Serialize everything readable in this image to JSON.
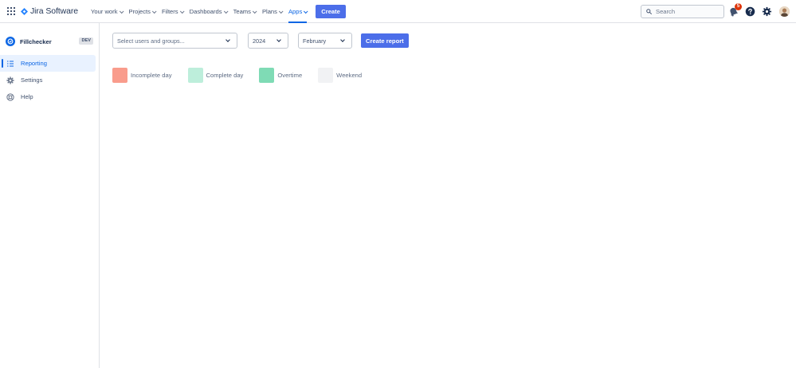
{
  "topnav": {
    "product_name": "Jira Software",
    "items": [
      {
        "label": "Your work",
        "active": false
      },
      {
        "label": "Projects",
        "active": false
      },
      {
        "label": "Filters",
        "active": false
      },
      {
        "label": "Dashboards",
        "active": false
      },
      {
        "label": "Teams",
        "active": false
      },
      {
        "label": "Plans",
        "active": false
      },
      {
        "label": "Apps",
        "active": true
      }
    ],
    "create_label": "Create",
    "search_placeholder": "Search",
    "notification_count": "5",
    "icons": [
      "app-switcher-icon",
      "jira-logo-icon",
      "search-icon",
      "notifications-icon",
      "help-icon",
      "settings-icon",
      "avatar"
    ]
  },
  "sidebar": {
    "project_name": "Fillchecker",
    "env_badge": "DEV",
    "items": [
      {
        "label": "Reporting",
        "icon": "list-icon",
        "active": true
      },
      {
        "label": "Settings",
        "icon": "gear-icon",
        "active": false
      },
      {
        "label": "Help",
        "icon": "lifebuoy-icon",
        "active": false
      }
    ]
  },
  "main": {
    "users_select_placeholder": "Select users and groups...",
    "year_value": "2024",
    "month_value": "February",
    "create_report_label": "Create report",
    "legend": [
      {
        "label": "Incomplete day",
        "color": "#f99c8c"
      },
      {
        "label": "Complete day",
        "color": "#bdeedb"
      },
      {
        "label": "Overtime",
        "color": "#7fdbb5"
      },
      {
        "label": "Weekend",
        "color": "#f1f2f4"
      }
    ]
  },
  "colors": {
    "accent": "#0c66e4",
    "button": "#4c6ee9",
    "badge": "#de350b"
  }
}
